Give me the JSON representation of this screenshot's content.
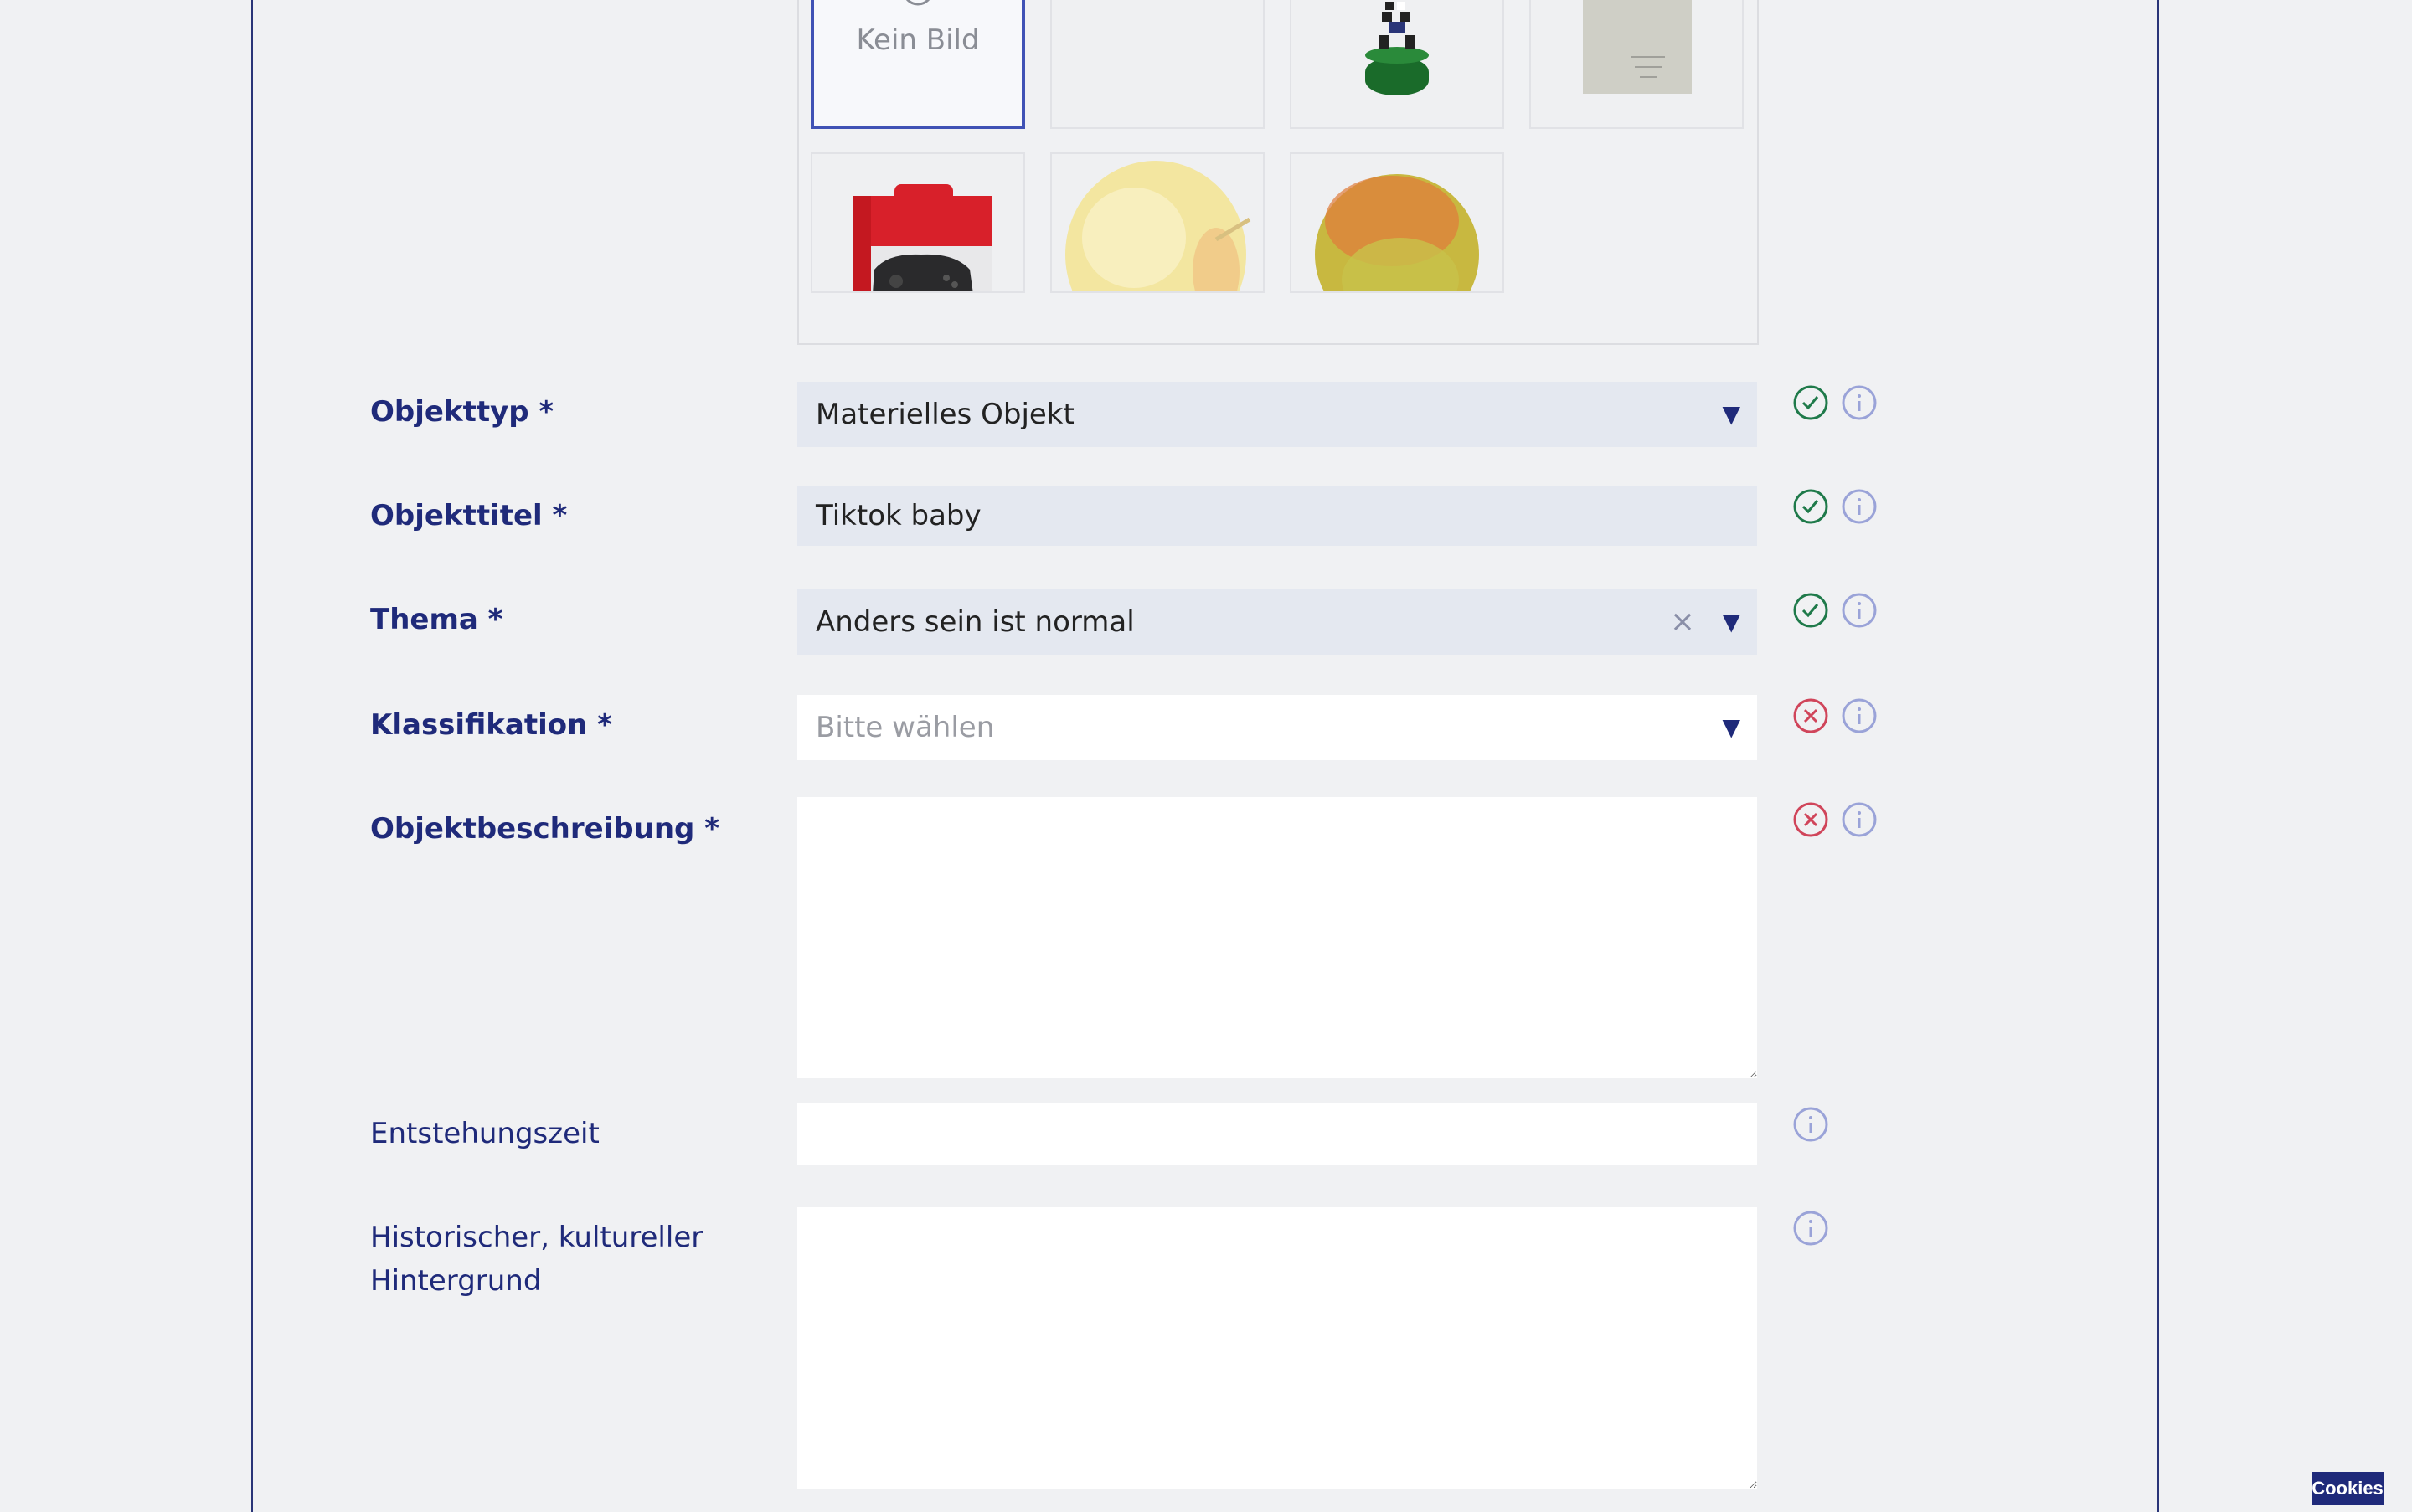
{
  "image_picker": {
    "no_image_label": "Kein Bild",
    "tiles": [
      {
        "name": "no-image",
        "selected": true
      },
      {
        "name": "empty"
      },
      {
        "name": "figurine"
      },
      {
        "name": "paper-note"
      },
      {
        "name": "nintendo-controller-box"
      },
      {
        "name": "pale-apple"
      },
      {
        "name": "yellow-apple"
      }
    ]
  },
  "form": {
    "objekttyp": {
      "label": "Objekttyp *",
      "value": "Materielles Objekt",
      "status": "valid"
    },
    "objekttitel": {
      "label": "Objekttitel *",
      "value": "Tiktok baby",
      "status": "valid"
    },
    "thema": {
      "label": "Thema *",
      "value": "Anders sein ist normal",
      "status": "valid"
    },
    "klassifikation": {
      "label": "Klassifikation *",
      "placeholder": "Bitte wählen",
      "status": "invalid"
    },
    "objektbeschreibung": {
      "label": "Objektbeschreibung *",
      "value": "",
      "status": "invalid"
    },
    "entstehungszeit": {
      "label": "Entstehungszeit",
      "value": ""
    },
    "hintergrund": {
      "label_line1": "Historischer, kultureller",
      "label_line2": "Hintergrund",
      "value": ""
    }
  },
  "icons": {
    "valid": "check-circle-icon",
    "invalid": "x-circle-icon",
    "info": "info-circle-icon",
    "dropdown": "triangle-down-icon",
    "clear": "clear-x-icon"
  },
  "colors": {
    "brand": "#1f2a7a",
    "valid": "#1f7a4a",
    "invalid": "#d0455a",
    "info": "#9aa3d8",
    "selected_border": "#4052b5"
  },
  "cookies_label": "Cookies"
}
